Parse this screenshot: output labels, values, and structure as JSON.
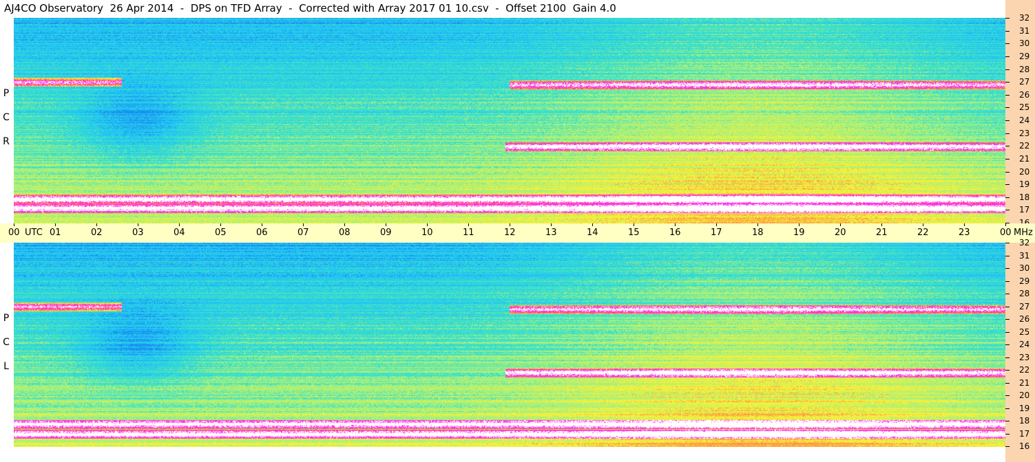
{
  "title": "AJ4CO Observatory  26 Apr 2014  -  DPS on TFD Array  -  Corrected with Array 2017 01 10.csv  -  Offset 2100  Gain 4.0",
  "chart_data": [
    {
      "type": "heatmap",
      "polarization_label": "R C P",
      "polarization_letters": [
        "R",
        "C",
        "P"
      ],
      "x_range_utc_hours": [
        0,
        24
      ],
      "y_range_mhz": [
        16,
        32
      ],
      "freq_tick_labels": [
        "32",
        "31",
        "30",
        "29",
        "28",
        "27",
        "26",
        "25",
        "24",
        "23",
        "22",
        "21",
        "20",
        "19",
        "18",
        "17",
        "16"
      ],
      "colormap": [
        "#1560e8",
        "#1a8ff0",
        "#22c6f2",
        "#3fe0c8",
        "#a8f07a",
        "#f0f040",
        "#ffa040",
        "#ff40a0",
        "#ff30ff",
        "#ffffff"
      ],
      "interference_bands_mhz": [
        27.0,
        26.8,
        22.0,
        17.9,
        17.2
      ],
      "interference_band_spans_utc_hours": [
        [
          0,
          2.6
        ],
        [
          12.0,
          24.0
        ],
        [
          11.9,
          24.0
        ],
        [
          0,
          24.0
        ],
        [
          0,
          24.0
        ]
      ]
    },
    {
      "type": "heatmap",
      "polarization_label": "L C P",
      "polarization_letters": [
        "L",
        "C",
        "P"
      ],
      "x_range_utc_hours": [
        0,
        24
      ],
      "y_range_mhz": [
        16,
        32
      ],
      "freq_tick_labels": [
        "32",
        "31",
        "30",
        "29",
        "28",
        "27",
        "26",
        "25",
        "24",
        "23",
        "22",
        "21",
        "20",
        "19",
        "18",
        "17",
        "16"
      ],
      "colormap": [
        "#1560e8",
        "#1a8ff0",
        "#22c6f2",
        "#3fe0c8",
        "#a8f07a",
        "#f0f040",
        "#ffa040",
        "#ff40a0",
        "#ff30ff",
        "#ffffff"
      ],
      "interference_bands_mhz": [
        27.0,
        26.8,
        21.8,
        17.8,
        17.0
      ],
      "interference_band_spans_utc_hours": [
        [
          0,
          2.6
        ],
        [
          12.0,
          24.0
        ],
        [
          11.9,
          24.0
        ],
        [
          0,
          24.0
        ],
        [
          0,
          24.0
        ]
      ]
    }
  ],
  "time_axis": {
    "labels": [
      "00",
      "UTC",
      "01",
      "02",
      "03",
      "04",
      "05",
      "06",
      "07",
      "08",
      "09",
      "10",
      "11",
      "12",
      "13",
      "14",
      "15",
      "16",
      "17",
      "18",
      "19",
      "20",
      "21",
      "22",
      "23",
      "00",
      "MHz"
    ]
  },
  "colors": {
    "side_strip": "#fbd5b0",
    "time_axis_bg": "#ffffc4"
  }
}
